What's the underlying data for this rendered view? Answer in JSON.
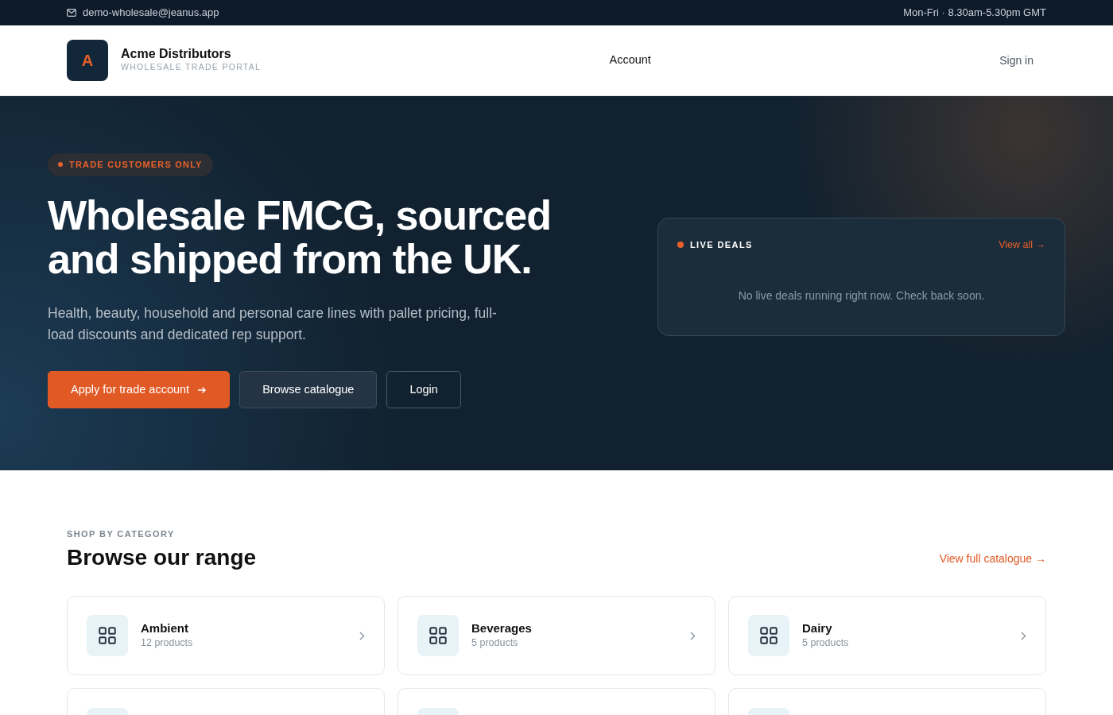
{
  "topbar": {
    "email": "demo-wholesale@jeanus.app",
    "hours": "Mon-Fri · 8.30am-5.30pm GMT"
  },
  "header": {
    "logo_letter": "A",
    "brand": "Acme Distributors",
    "tagline": "WHOLESALE TRADE PORTAL",
    "nav": [
      {
        "label": "Account"
      }
    ],
    "sign_in": "Sign in"
  },
  "hero": {
    "badge": "TRADE CUSTOMERS ONLY",
    "title": "Wholesale FMCG, sourced and shipped from the UK.",
    "subtitle": "Health, beauty, household and personal care lines with pallet pricing, full-load discounts and dedicated rep support.",
    "buttons": [
      {
        "label": "Apply for trade account",
        "kind": "primary"
      },
      {
        "label": "Browse catalogue",
        "kind": "secondary"
      },
      {
        "label": "Login",
        "kind": "outline"
      }
    ],
    "deals": {
      "title": "LIVE DEALS",
      "link": "View all →",
      "empty": "No live deals running right now. Check back soon."
    }
  },
  "categories_section": {
    "eyebrow": "SHOP BY CATEGORY",
    "title": "Browse our range",
    "link": "View full catalogue →",
    "categories": [
      {
        "kind": "full",
        "name": "Ambient",
        "count": "12 products"
      },
      {
        "kind": "full",
        "name": "Beverages",
        "count": "5 products"
      },
      {
        "kind": "full",
        "name": "Dairy",
        "count": "5 products"
      },
      {
        "kind": "partial"
      },
      {
        "kind": "partial"
      },
      {
        "kind": "partial"
      }
    ]
  }
}
